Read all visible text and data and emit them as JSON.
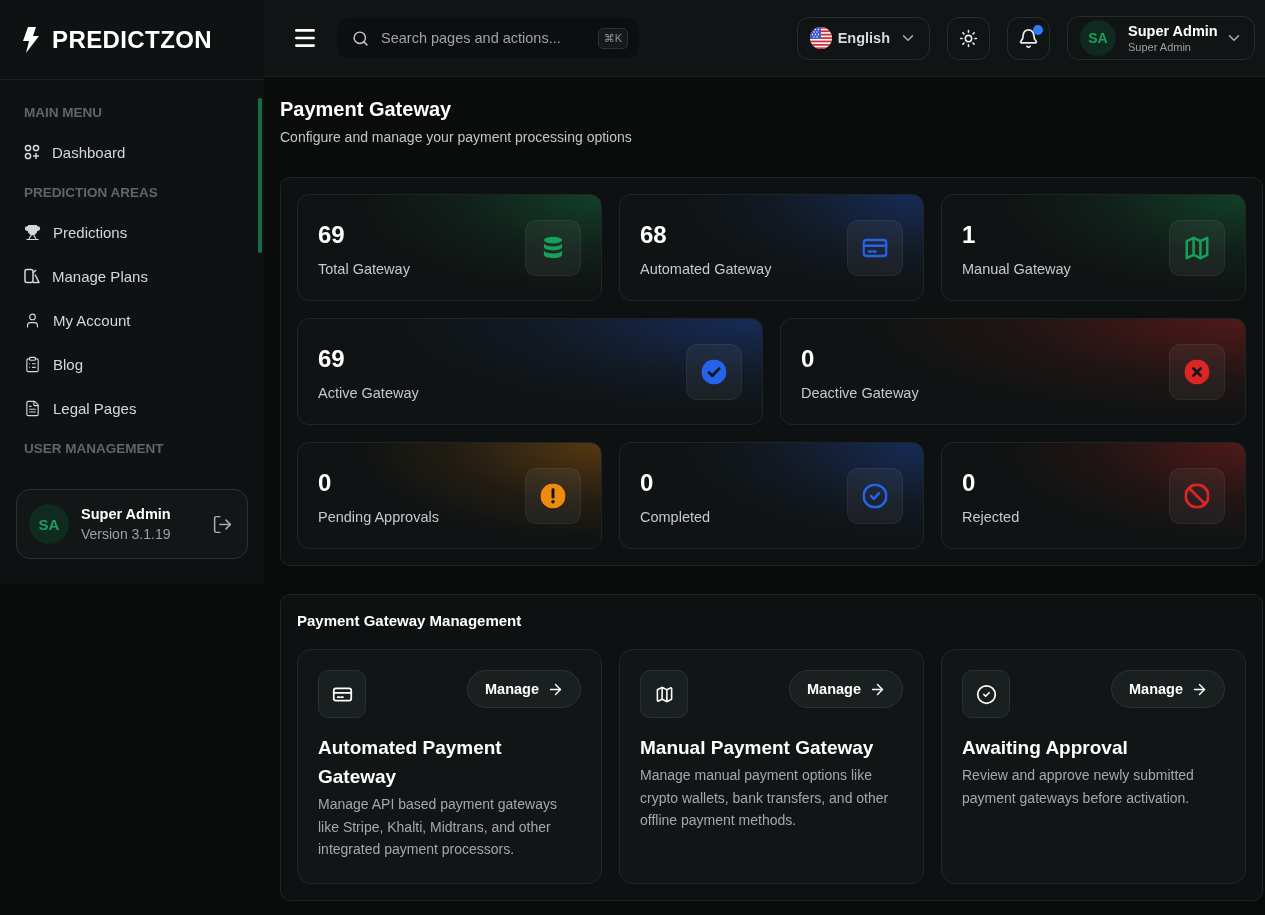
{
  "sidebar": {
    "logo": "PREDICTZON",
    "sections": [
      {
        "heading": "MAIN MENU",
        "items": [
          {
            "label": "Dashboard"
          }
        ]
      },
      {
        "heading": "PREDICTION AREAS",
        "items": [
          {
            "label": "Predictions"
          },
          {
            "label": "Manage Plans"
          },
          {
            "label": "My Account"
          },
          {
            "label": "Blog"
          },
          {
            "label": "Legal Pages"
          }
        ]
      },
      {
        "heading": "USER MANAGEMENT"
      }
    ],
    "user_card": {
      "initials": "SA",
      "name": "Super Admin",
      "version": "Version 3.1.19"
    }
  },
  "header": {
    "search": {
      "placeholder": "Search pages and actions...",
      "shortcut": "⌘K"
    },
    "language": "English",
    "notifications": {
      "unread": true
    },
    "user": {
      "initials": "SA",
      "name": "Super Admin",
      "role": "Super Admin"
    }
  },
  "page": {
    "title": "Payment Gateway",
    "subtitle": "Configure and manage your payment processing options"
  },
  "stat_rows": [
    {
      "cards": [
        {
          "value": "69",
          "label": "Total Gateway",
          "color": "#16a05a"
        },
        {
          "value": "68",
          "label": "Automated Gateway",
          "color": "#2563eb"
        },
        {
          "value": "1",
          "label": "Manual Gateway",
          "color": "#16a05a"
        }
      ]
    },
    {
      "cards": [
        {
          "value": "69",
          "label": "Active Gateway",
          "color": "#2563eb"
        },
        {
          "value": "0",
          "label": "Deactive Gateway",
          "color": "#dc2626"
        }
      ]
    },
    {
      "cards": [
        {
          "value": "0",
          "label": "Pending Approvals",
          "color": "#ef8a0c"
        },
        {
          "value": "0",
          "label": "Completed",
          "color": "#2563eb"
        },
        {
          "value": "0",
          "label": "Rejected",
          "color": "#dc2626"
        }
      ]
    }
  ],
  "management": {
    "title": "Payment Gateway Management",
    "cards": [
      {
        "title": "Automated Payment Gateway",
        "description": "Manage API based payment gateways like Stripe, Khalti, Midtrans, and other integrated payment processors.",
        "button": "Manage"
      },
      {
        "title": "Manual Payment Gateway",
        "description": "Manage manual payment options like crypto wallets, bank transfers, and other offline payment methods.",
        "button": "Manage"
      },
      {
        "title": "Awaiting Approval",
        "description": "Review and approve newly submitted payment gateways before activation.",
        "button": "Manage"
      }
    ]
  }
}
